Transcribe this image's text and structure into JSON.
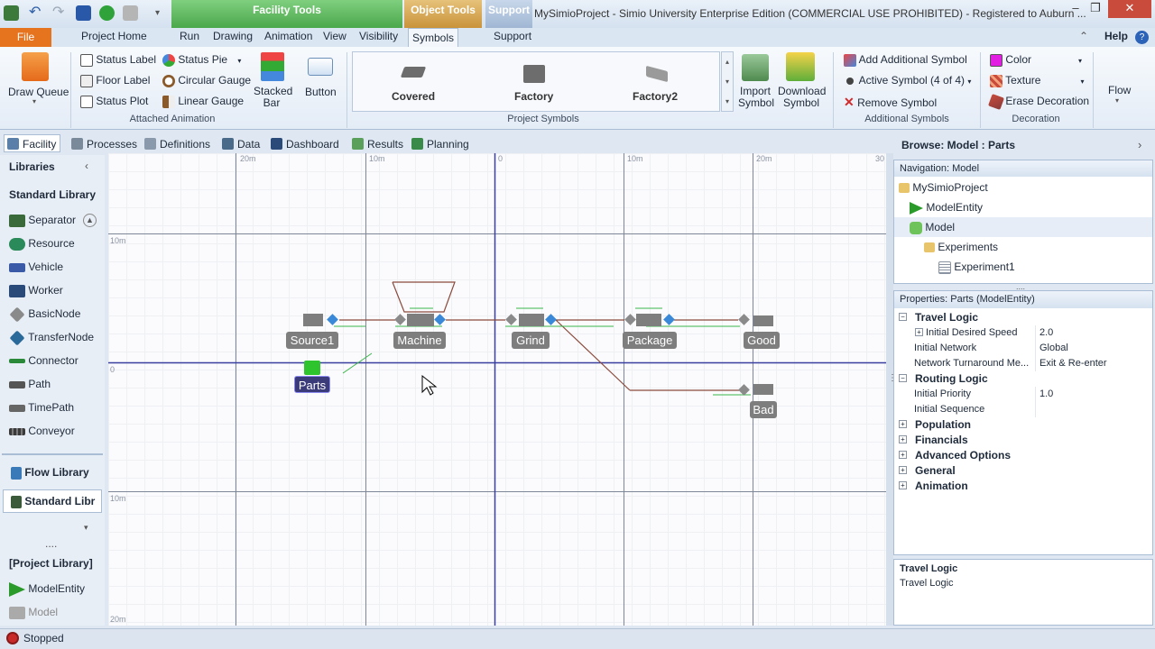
{
  "title_bar": {
    "app_title": "MySimioProject - Simio University Enterprise Edition (COMMERCIAL USE PROHIBITED) - Registered to Auburn ...",
    "context_tabs": [
      "Facility Tools",
      "Object Tools",
      "Support"
    ],
    "window_buttons": [
      "–",
      "❐",
      "✕"
    ]
  },
  "ribbon_tabs": {
    "file": "File",
    "tabs": [
      "Project Home",
      "Run",
      "Drawing",
      "Animation",
      "View",
      "Visibility",
      "Symbols",
      "Support"
    ],
    "active": "Symbols",
    "help": "Help"
  },
  "ribbon": {
    "draw_queue": "Draw Queue",
    "attached_animation": {
      "items": [
        "Status Label",
        "Floor Label",
        "Status Plot",
        "Status Pie",
        "Circular Gauge",
        "Linear Gauge"
      ],
      "stacked_bar": "Stacked Bar",
      "button": "Button",
      "group_label": "Attached Animation"
    },
    "project_symbols": {
      "items": [
        "Covered",
        "Factory",
        "Factory2"
      ],
      "group_label": "Project Symbols"
    },
    "import_symbol": "Import Symbol",
    "download_symbol": "Download Symbol",
    "additional_symbols": {
      "add": "Add Additional Symbol",
      "active": "Active Symbol (4 of 4)",
      "remove": "Remove Symbol",
      "group_label": "Additional Symbols"
    },
    "decoration": {
      "color": "Color",
      "texture": "Texture",
      "erase": "Erase Decoration",
      "group_label": "Decoration"
    },
    "flow": "Flow"
  },
  "view_tabs": [
    "Facility",
    "Processes",
    "Definitions",
    "Data",
    "Dashboard",
    "Results",
    "Planning"
  ],
  "libraries": {
    "header": "Libraries",
    "standard_title": "Standard Library",
    "items": [
      "Separator",
      "Resource",
      "Vehicle",
      "Worker",
      "BasicNode",
      "TransferNode",
      "Connector",
      "Path",
      "TimePath",
      "Conveyor"
    ],
    "flow_library": "Flow Library",
    "standard_library_tab": "Standard Libr",
    "more": "....",
    "project_library": "[Project Library]",
    "project_items": [
      "ModelEntity",
      "Model"
    ]
  },
  "canvas": {
    "ruler_top": [
      "20m",
      "10m",
      "0",
      "10m",
      "20m",
      "30"
    ],
    "ruler_left": [
      "10m",
      "0",
      "10m",
      "20m"
    ],
    "objects": {
      "source": "Source1",
      "machine": "Machine",
      "grind": "Grind",
      "package": "Package",
      "good": "Good",
      "bad": "Bad",
      "parts": "Parts"
    }
  },
  "browse": {
    "header": "Browse: Model : Parts",
    "nav_header": "Navigation: Model",
    "nav_items": [
      "MySimioProject",
      "ModelEntity",
      "Model",
      "Experiments",
      "Experiment1"
    ],
    "props_header": "Properties: Parts (ModelEntity)",
    "properties": [
      {
        "label": "Travel Logic",
        "value": "",
        "category": true
      },
      {
        "label": "Initial Desired Speed",
        "value": "2.0",
        "category": false
      },
      {
        "label": "Initial Network",
        "value": "Global",
        "category": false
      },
      {
        "label": "Network Turnaround Me...",
        "value": "Exit & Re-enter",
        "category": false
      },
      {
        "label": "Routing Logic",
        "value": "",
        "category": true
      },
      {
        "label": "Initial Priority",
        "value": "1.0",
        "category": false
      },
      {
        "label": "Initial Sequence",
        "value": "",
        "category": false
      },
      {
        "label": "Population",
        "value": "",
        "category": true
      },
      {
        "label": "Financials",
        "value": "",
        "category": true
      },
      {
        "label": "Advanced Options",
        "value": "",
        "category": true
      },
      {
        "label": "General",
        "value": "",
        "category": true
      },
      {
        "label": "Animation",
        "value": "",
        "category": true
      }
    ],
    "desc_title": "Travel Logic",
    "desc_text": "Travel Logic"
  },
  "status": {
    "text": "Stopped"
  },
  "colors": {
    "file_tab": "#e6731e",
    "context_green": "#6fbf6f",
    "context_gold": "#d7a84d",
    "node_blue": "#3a88d8",
    "selected_entity": "#3b3b7a"
  }
}
